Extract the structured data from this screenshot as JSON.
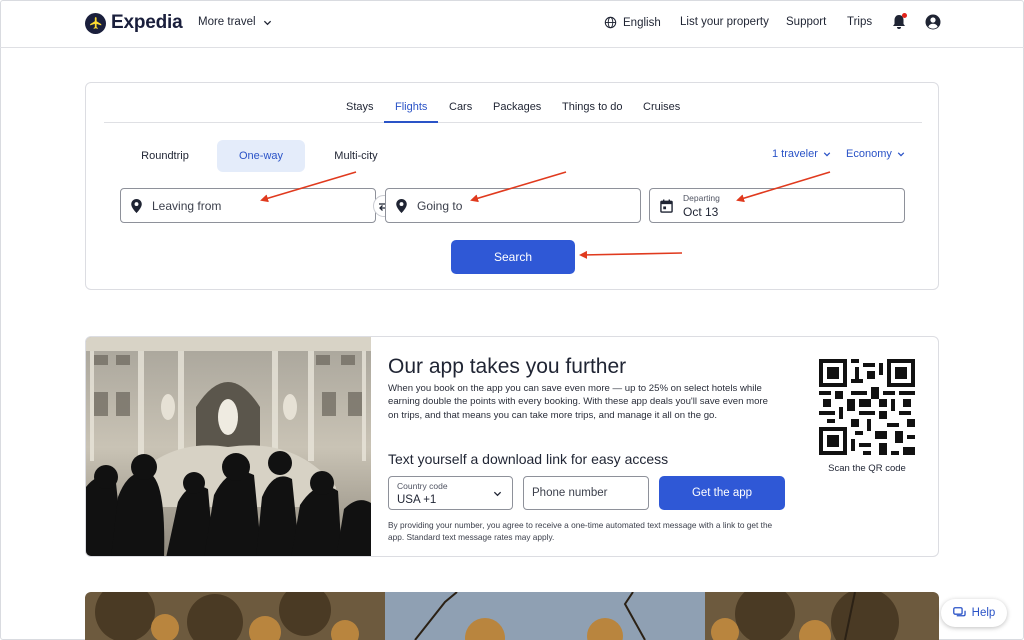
{
  "header": {
    "brand": "Expedia",
    "more_travel": "More travel",
    "language": "English",
    "list_property": "List your property",
    "support": "Support",
    "trips": "Trips"
  },
  "search": {
    "tabs": [
      {
        "label": "Stays",
        "active": false
      },
      {
        "label": "Flights",
        "active": true
      },
      {
        "label": "Cars",
        "active": false
      },
      {
        "label": "Packages",
        "active": false
      },
      {
        "label": "Things to do",
        "active": false
      },
      {
        "label": "Cruises",
        "active": false
      }
    ],
    "trip_types": [
      {
        "label": "Roundtrip",
        "active": false
      },
      {
        "label": "One-way",
        "active": true
      },
      {
        "label": "Multi-city",
        "active": false
      }
    ],
    "travelers": "1 traveler",
    "cabin_class": "Economy",
    "leaving_from_placeholder": "Leaving from",
    "going_to_placeholder": "Going to",
    "departing_label": "Departing",
    "departing_value": "Oct 13",
    "search_button": "Search"
  },
  "promo": {
    "title": "Our app takes you further",
    "body": "When you book on the app you can save even more — up to 25% on select hotels while earning double the points with every booking. With these app deals you'll save even more on trips, and that means you can take more trips, and manage it all on the go.",
    "subtitle": "Text yourself a download link for easy access",
    "country_code_label": "Country code",
    "country_code_value": "USA +1",
    "phone_placeholder": "Phone number",
    "get_app_button": "Get the app",
    "disclaimer": "By providing your number, you agree to receive a one-time automated text message with a link to get the app. Standard text message rates may apply.",
    "qr_label": "Scan the QR code"
  },
  "help_button": "Help",
  "colors": {
    "brand_navy": "#1a1f3c",
    "accent_blue": "#2f58d6",
    "link_blue": "#2a53c7",
    "annotation_red": "#e03a1e"
  }
}
